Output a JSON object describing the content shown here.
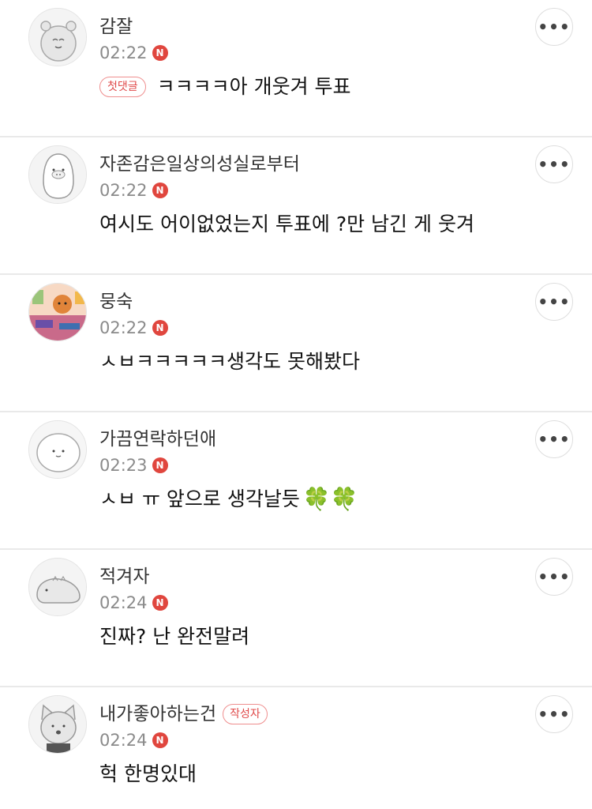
{
  "comments": [
    {
      "author": "감잘",
      "time": "02:22",
      "new_badge": "N",
      "first_badge": "첫댓글",
      "text": "ㅋㅋㅋㅋ아 개웃겨 투표",
      "avatar_icon": "hamster-avatar-icon",
      "more_label": "•••"
    },
    {
      "author": "자존감은일상의성실로부터",
      "time": "02:22",
      "new_badge": "N",
      "text": "여시도 어이없었는지 투표에 ?만 남긴 게 웃겨",
      "avatar_icon": "penguin-avatar-icon",
      "more_label": "•••"
    },
    {
      "author": "뭉숙",
      "time": "02:22",
      "new_badge": "N",
      "text": "ㅅㅂㅋㅋㅋㅋㅋ생각도 못해봤다",
      "avatar_icon": "illustration-avatar-icon",
      "more_label": "•••"
    },
    {
      "author": "가끔연락하던애",
      "time": "02:23",
      "new_badge": "N",
      "text": "ㅅㅂ ㅠ 앞으로 생각날듯",
      "clover": "🍀🍀",
      "avatar_icon": "rice-cake-avatar-icon",
      "more_label": "•••"
    },
    {
      "author": "적겨자",
      "time": "02:24",
      "new_badge": "N",
      "text": "진짜? 난 완전말려",
      "avatar_icon": "dino-avatar-icon",
      "more_label": "•••"
    },
    {
      "author": "내가좋아하는건",
      "author_badge": "작성자",
      "time": "02:24",
      "new_badge": "N",
      "text": "헉 한명있대",
      "avatar_icon": "cat-avatar-icon",
      "more_label": "•••"
    }
  ],
  "colors": {
    "new_badge": "#e0463e",
    "badge_border": "#ef8f8f",
    "divider": "#e9e9e9"
  }
}
